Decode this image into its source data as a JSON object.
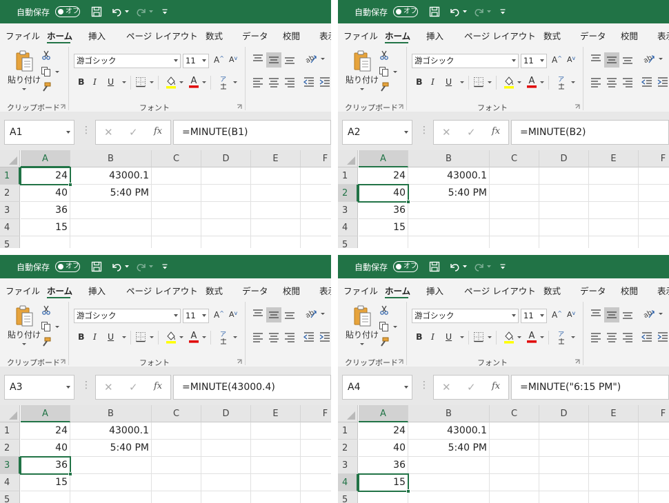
{
  "common": {
    "autosave_label": "自動保存",
    "autosave_state": "オフ",
    "tabs": [
      "ファイル",
      "ホーム",
      "挿入",
      "ページ レイアウト",
      "数式",
      "データ",
      "校閲",
      "表示"
    ],
    "ribbon": {
      "paste_label": "貼り付け",
      "clipboard_label": "クリップボード",
      "font_name": "游ゴシック",
      "font_size": "11",
      "font_group_label": "フォント",
      "bold": "B",
      "italic": "I",
      "underline": "U",
      "grow_font": "A",
      "shrink_font": "A",
      "phonetic": "ア"
    },
    "columns": [
      "A",
      "B",
      "C",
      "D",
      "E",
      "F"
    ],
    "rows": [
      "1",
      "2",
      "3",
      "4",
      "5"
    ],
    "cells": {
      "A": [
        "24",
        "40",
        "36",
        "15",
        ""
      ],
      "B": [
        "43000.1",
        "5:40 PM",
        "",
        "",
        ""
      ]
    },
    "colors": {
      "excel_green": "#217346",
      "font_color_red": "#e00000",
      "highlight_yellow": "#ffff00"
    }
  },
  "panels": [
    {
      "name_box": "A1",
      "formula": "=MINUTE(B1)",
      "selected_row": 1
    },
    {
      "name_box": "A2",
      "formula": "=MINUTE(B2)",
      "selected_row": 2
    },
    {
      "name_box": "A3",
      "formula": "=MINUTE(43000.4)",
      "selected_row": 3
    },
    {
      "name_box": "A4",
      "formula": "=MINUTE(\"6:15 PM\")",
      "selected_row": 4
    }
  ]
}
